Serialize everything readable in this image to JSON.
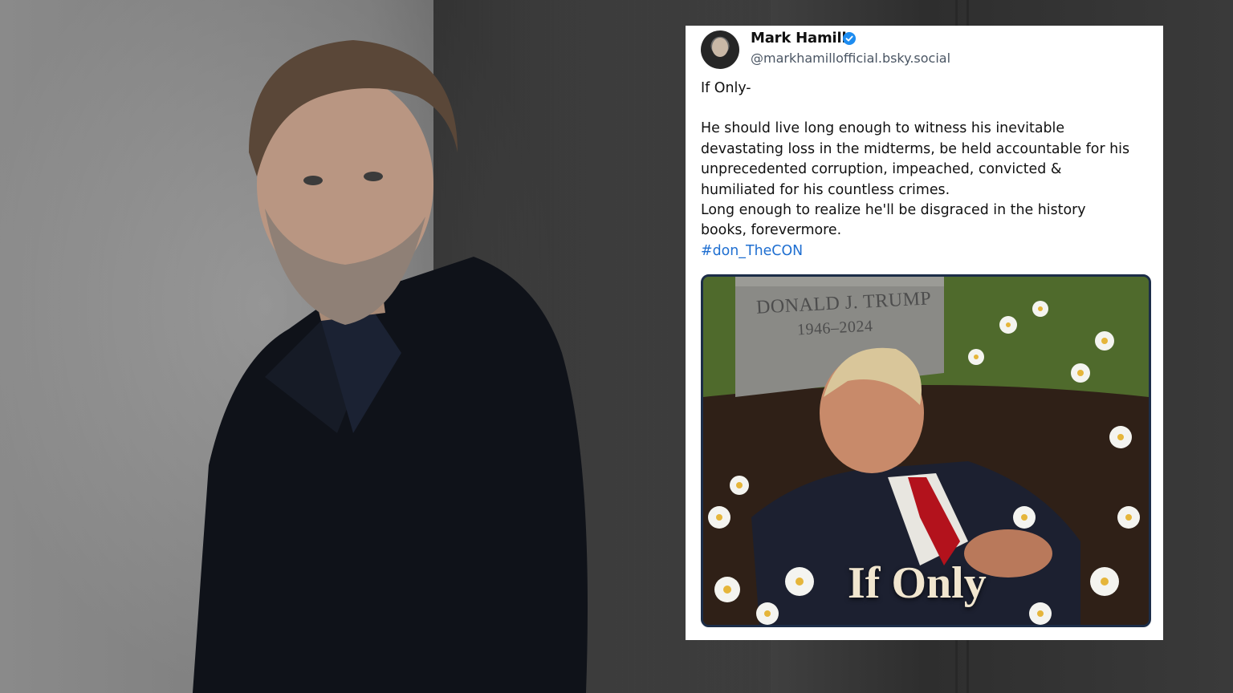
{
  "post": {
    "author_name": "Mark Hamill",
    "handle": "@markhamillofficial.bsky.social",
    "verified_icon": "verified-badge-icon",
    "lines": {
      "l1": "If Only-",
      "l2": "He should live long enough to witness his inevitable",
      "l3": "devastating loss in the midterms, be held accountable for his",
      "l4": "unprecedented corruption, impeached, convicted &",
      "l5": "humiliated for his countless crimes.",
      "l6": "Long enough to realize he'll be disgraced in the history",
      "l7": "books, forevermore.",
      "hashtag": "#don_TheCON"
    },
    "image": {
      "tombstone_name": "DONALD J. TRUMP",
      "tombstone_years": "1946–2024",
      "caption": "If Only"
    }
  },
  "colors": {
    "hashtag": "#1f6fd1",
    "verified": "#1d8cf0",
    "image_border": "#1c2d48"
  }
}
